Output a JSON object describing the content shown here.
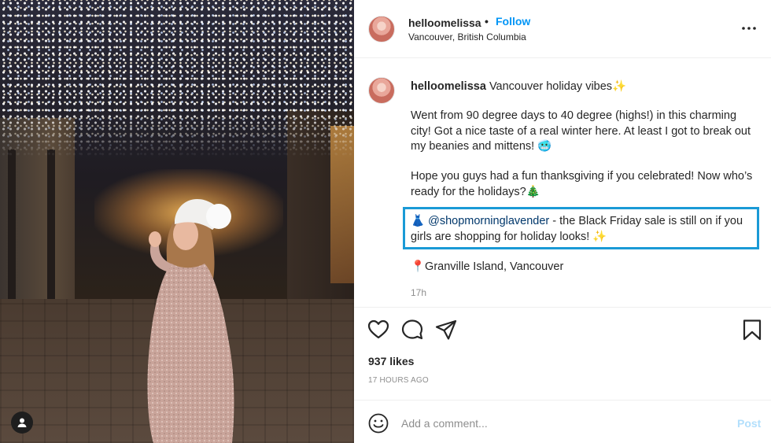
{
  "post": {
    "image_alt": "Woman in pink sequin dress and white beanie under holiday lights",
    "username": "helloomelissa",
    "follow_label": "Follow",
    "location": "Vancouver, British Columbia",
    "dot": "•"
  },
  "caption": {
    "username": "helloomelissa",
    "headline": "Vancouver holiday vibes",
    "headline_emoji": "✨",
    "p1": "Went from 90 degree days to 40 degree (highs!) in this charming city! Got a nice taste of a real winter here. At least I got to break out my beanies and mittens! 🥶",
    "p2": "Hope you guys had a fun thanksgiving if you celebrated! Now who’s ready for the holidays?🎄",
    "p3_prefix_emoji": "👗",
    "p3_mention": "@shopmorninglavender",
    "p3_rest": " - the Black Friday sale is still on if you girls are shopping for holiday looks! ✨",
    "p4": "📍Granville Island, Vancouver",
    "time": "17h"
  },
  "actions": {
    "likes": "937 likes",
    "ago": "17 HOURS AGO"
  },
  "comment": {
    "placeholder": "Add a comment...",
    "post_label": "Post"
  },
  "colors": {
    "accent": "#0095f6",
    "highlight_border": "#1a9ad6",
    "post_disabled": "#b2dffc"
  }
}
